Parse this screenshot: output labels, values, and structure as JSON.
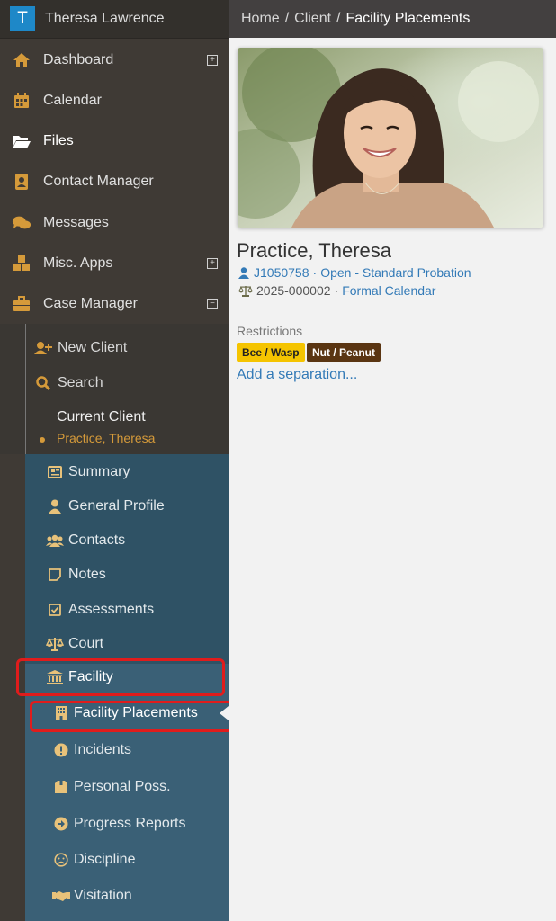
{
  "app": {
    "logo_letter": "T",
    "user_name": "Theresa Lawrence"
  },
  "breadcrumb": {
    "items": [
      "Home",
      "Client"
    ],
    "current": "Facility Placements",
    "separator": "/"
  },
  "nav": {
    "items": [
      {
        "label": "Dashboard",
        "icon": "home-icon",
        "expandable": true
      },
      {
        "label": "Calendar",
        "icon": "calendar-icon"
      },
      {
        "label": "Files",
        "icon": "folder-open-icon"
      },
      {
        "label": "Contact Manager",
        "icon": "address-book-icon"
      },
      {
        "label": "Messages",
        "icon": "comments-icon"
      },
      {
        "label": "Misc. Apps",
        "icon": "cubes-icon",
        "expandable": true
      },
      {
        "label": "Case Manager",
        "icon": "briefcase-icon",
        "expanded": true
      }
    ]
  },
  "case_manager": {
    "new_client": "New Client",
    "search": "Search",
    "current_client_title": "Current Client",
    "current_client_name": "Practice, Theresa"
  },
  "client_menu": {
    "items": [
      "Summary",
      "General Profile",
      "Contacts",
      "Notes",
      "Assessments",
      "Court",
      "Facility"
    ],
    "facility_sub": [
      "Facility Placements",
      "Incidents",
      "Personal Poss.",
      "Progress Reports",
      "Discipline",
      "Visitation"
    ]
  },
  "client": {
    "name": "Practice, Theresa",
    "case_id": "J1050758",
    "case_status": "Open - Standard Probation",
    "court_no": "2025-000002",
    "calendar": "Formal Calendar",
    "restrictions_label": "Restrictions",
    "restrictions": [
      "Bee / Wasp",
      "Nut / Peanut"
    ],
    "add_separation": "Add a separation..."
  },
  "colors": {
    "accent": "#d59a3a",
    "sidebar": "#3f3a35",
    "client_menu": "#3a6076",
    "link": "#337ab7",
    "highlight": "#e01c1c"
  }
}
